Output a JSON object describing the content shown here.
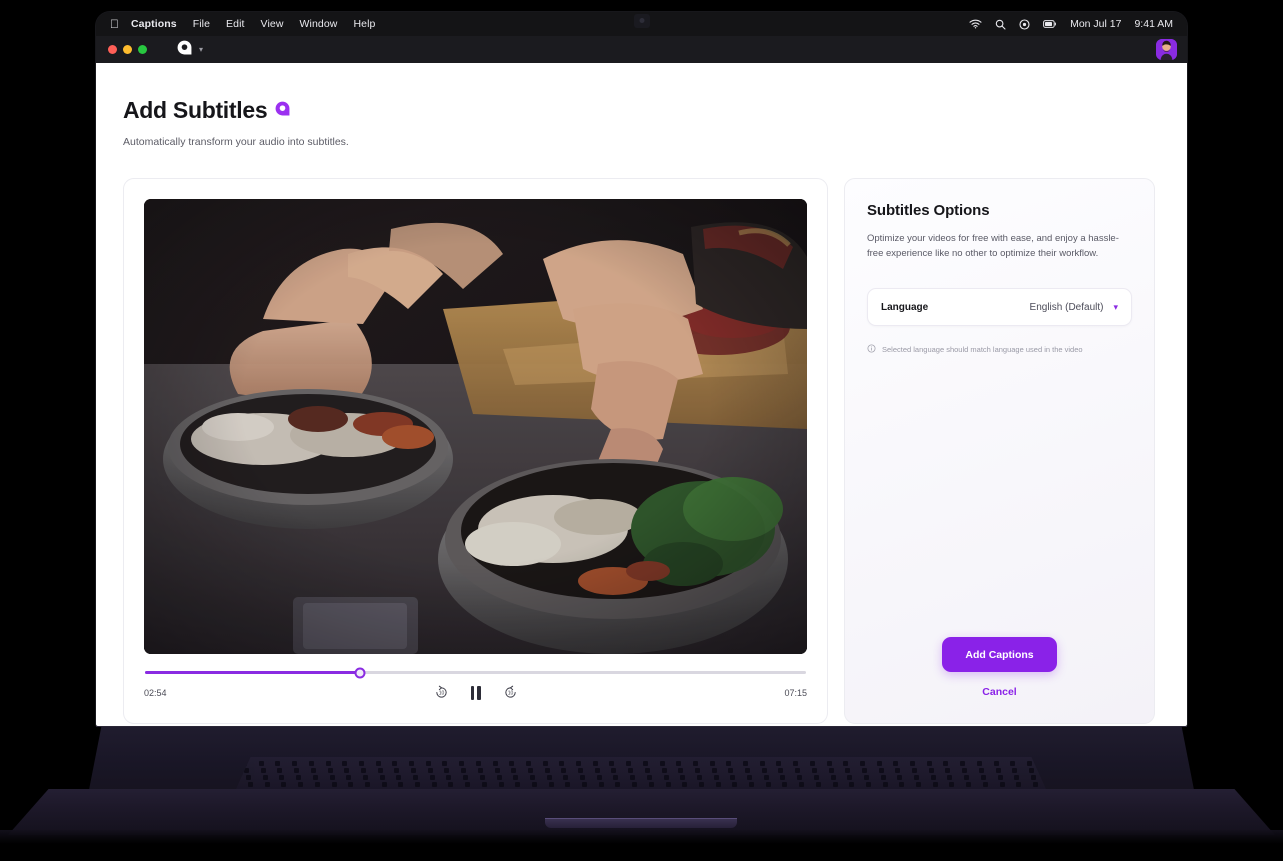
{
  "menubar": {
    "apple_icon": "apple-icon",
    "items": [
      "Captions",
      "File",
      "Edit",
      "View",
      "Window",
      "Help"
    ],
    "status_icons": [
      "wifi-icon",
      "search-icon",
      "control-center-icon",
      "battery-icon"
    ],
    "date": "Mon Jul 17",
    "time": "9:41 AM"
  },
  "titlebar": {
    "traffic_lights": [
      "close-button",
      "minimize-button",
      "maximize-button"
    ],
    "app_logo": "captions-logo-icon",
    "chevron": "chevron-down-icon",
    "avatar": "user-avatar"
  },
  "page": {
    "title": "Add Subtitles",
    "title_logo": "captions-logo-icon",
    "subtitle": "Automatically transform your audio into subtitles."
  },
  "player": {
    "current_time": "02:54",
    "duration": "07:15",
    "progress_percent": 32.5,
    "rewind_icon": "rewind-10-icon",
    "pause_icon": "pause-icon",
    "forward_icon": "forward-10-icon"
  },
  "options": {
    "title": "Subtitles Options",
    "description": "Optimize your videos for free with ease, and enjoy a hassle-free experience like no other to optimize their workflow.",
    "language_label": "Language",
    "language_value": "English (Default)",
    "language_chevron": "chevron-down-icon",
    "hint_icon": "info-icon",
    "hint": "Selected language should match language used in the video",
    "primary_button": "Add Captions",
    "cancel_button": "Cancel"
  },
  "colors": {
    "accent": "#8a22e8",
    "accent_light": "#9b4dee",
    "text_dark": "#16161a",
    "text_muted": "#5a5a66",
    "card_border": "#ececf1"
  }
}
